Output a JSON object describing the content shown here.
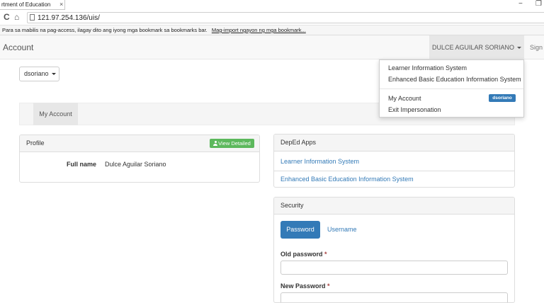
{
  "browser": {
    "tab_title": "rtment of Education",
    "tab_close": "×",
    "address": "121.97.254.136/uis/",
    "minimize_glyph": "−",
    "restore_glyph": "❐",
    "back_glyph": "C",
    "home_glyph": "⌂",
    "bookmarks_text": "Para sa mabilis na pag-access, ilagay dito ang iyong mga bookmark sa bookmarks bar.",
    "bookmarks_link": "Mag-import ngayon ng mga bookmark..."
  },
  "navbar": {
    "brand": "Account",
    "user_name": "DULCE AGUILAR SORIANO",
    "sign_link": "Sign"
  },
  "dropdown": {
    "items": [
      "Learner Information System",
      "Enhanced Basic Education Information System"
    ],
    "my_account": "My Account",
    "badge": "dsoriano",
    "exit": "Exit Impersonation"
  },
  "user_button": "dsoriano",
  "subnav": {
    "tab": "My Account"
  },
  "profile": {
    "heading": "Profile",
    "view_button": "View Detailed",
    "full_name_label": "Full name",
    "full_name_value": "Dulce Aguilar Soriano"
  },
  "apps": {
    "heading": "DepEd Apps",
    "links": [
      "Learner Information System",
      "Enhanced Basic Education Information System"
    ]
  },
  "security": {
    "heading": "Security",
    "tabs": [
      "Password",
      "Username"
    ],
    "old_password_label": "Old password",
    "new_password_label": "New Password",
    "required_mark": "*"
  },
  "colors": {
    "primary": "#337ab7",
    "success": "#5cb85c",
    "required": "#a94442"
  }
}
